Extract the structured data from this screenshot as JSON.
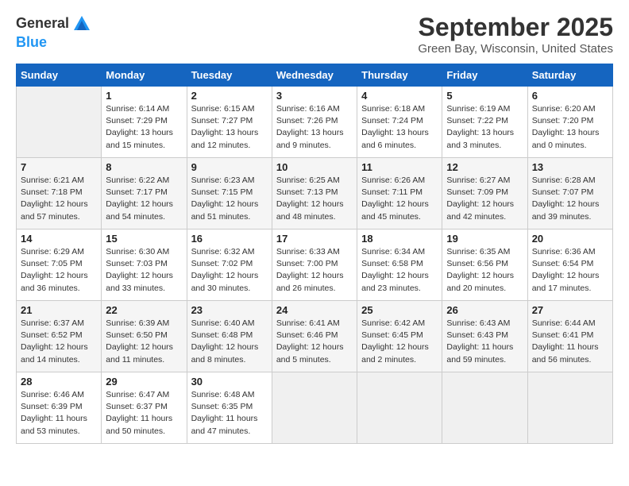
{
  "header": {
    "logo": {
      "line1": "General",
      "line2": "Blue"
    },
    "month": "September 2025",
    "location": "Green Bay, Wisconsin, United States"
  },
  "weekdays": [
    "Sunday",
    "Monday",
    "Tuesday",
    "Wednesday",
    "Thursday",
    "Friday",
    "Saturday"
  ],
  "weeks": [
    [
      {
        "day": "",
        "sunrise": "",
        "sunset": "",
        "daylight": ""
      },
      {
        "day": "1",
        "sunrise": "Sunrise: 6:14 AM",
        "sunset": "Sunset: 7:29 PM",
        "daylight": "Daylight: 13 hours and 15 minutes."
      },
      {
        "day": "2",
        "sunrise": "Sunrise: 6:15 AM",
        "sunset": "Sunset: 7:27 PM",
        "daylight": "Daylight: 13 hours and 12 minutes."
      },
      {
        "day": "3",
        "sunrise": "Sunrise: 6:16 AM",
        "sunset": "Sunset: 7:26 PM",
        "daylight": "Daylight: 13 hours and 9 minutes."
      },
      {
        "day": "4",
        "sunrise": "Sunrise: 6:18 AM",
        "sunset": "Sunset: 7:24 PM",
        "daylight": "Daylight: 13 hours and 6 minutes."
      },
      {
        "day": "5",
        "sunrise": "Sunrise: 6:19 AM",
        "sunset": "Sunset: 7:22 PM",
        "daylight": "Daylight: 13 hours and 3 minutes."
      },
      {
        "day": "6",
        "sunrise": "Sunrise: 6:20 AM",
        "sunset": "Sunset: 7:20 PM",
        "daylight": "Daylight: 13 hours and 0 minutes."
      }
    ],
    [
      {
        "day": "7",
        "sunrise": "Sunrise: 6:21 AM",
        "sunset": "Sunset: 7:18 PM",
        "daylight": "Daylight: 12 hours and 57 minutes."
      },
      {
        "day": "8",
        "sunrise": "Sunrise: 6:22 AM",
        "sunset": "Sunset: 7:17 PM",
        "daylight": "Daylight: 12 hours and 54 minutes."
      },
      {
        "day": "9",
        "sunrise": "Sunrise: 6:23 AM",
        "sunset": "Sunset: 7:15 PM",
        "daylight": "Daylight: 12 hours and 51 minutes."
      },
      {
        "day": "10",
        "sunrise": "Sunrise: 6:25 AM",
        "sunset": "Sunset: 7:13 PM",
        "daylight": "Daylight: 12 hours and 48 minutes."
      },
      {
        "day": "11",
        "sunrise": "Sunrise: 6:26 AM",
        "sunset": "Sunset: 7:11 PM",
        "daylight": "Daylight: 12 hours and 45 minutes."
      },
      {
        "day": "12",
        "sunrise": "Sunrise: 6:27 AM",
        "sunset": "Sunset: 7:09 PM",
        "daylight": "Daylight: 12 hours and 42 minutes."
      },
      {
        "day": "13",
        "sunrise": "Sunrise: 6:28 AM",
        "sunset": "Sunset: 7:07 PM",
        "daylight": "Daylight: 12 hours and 39 minutes."
      }
    ],
    [
      {
        "day": "14",
        "sunrise": "Sunrise: 6:29 AM",
        "sunset": "Sunset: 7:05 PM",
        "daylight": "Daylight: 12 hours and 36 minutes."
      },
      {
        "day": "15",
        "sunrise": "Sunrise: 6:30 AM",
        "sunset": "Sunset: 7:03 PM",
        "daylight": "Daylight: 12 hours and 33 minutes."
      },
      {
        "day": "16",
        "sunrise": "Sunrise: 6:32 AM",
        "sunset": "Sunset: 7:02 PM",
        "daylight": "Daylight: 12 hours and 30 minutes."
      },
      {
        "day": "17",
        "sunrise": "Sunrise: 6:33 AM",
        "sunset": "Sunset: 7:00 PM",
        "daylight": "Daylight: 12 hours and 26 minutes."
      },
      {
        "day": "18",
        "sunrise": "Sunrise: 6:34 AM",
        "sunset": "Sunset: 6:58 PM",
        "daylight": "Daylight: 12 hours and 23 minutes."
      },
      {
        "day": "19",
        "sunrise": "Sunrise: 6:35 AM",
        "sunset": "Sunset: 6:56 PM",
        "daylight": "Daylight: 12 hours and 20 minutes."
      },
      {
        "day": "20",
        "sunrise": "Sunrise: 6:36 AM",
        "sunset": "Sunset: 6:54 PM",
        "daylight": "Daylight: 12 hours and 17 minutes."
      }
    ],
    [
      {
        "day": "21",
        "sunrise": "Sunrise: 6:37 AM",
        "sunset": "Sunset: 6:52 PM",
        "daylight": "Daylight: 12 hours and 14 minutes."
      },
      {
        "day": "22",
        "sunrise": "Sunrise: 6:39 AM",
        "sunset": "Sunset: 6:50 PM",
        "daylight": "Daylight: 12 hours and 11 minutes."
      },
      {
        "day": "23",
        "sunrise": "Sunrise: 6:40 AM",
        "sunset": "Sunset: 6:48 PM",
        "daylight": "Daylight: 12 hours and 8 minutes."
      },
      {
        "day": "24",
        "sunrise": "Sunrise: 6:41 AM",
        "sunset": "Sunset: 6:46 PM",
        "daylight": "Daylight: 12 hours and 5 minutes."
      },
      {
        "day": "25",
        "sunrise": "Sunrise: 6:42 AM",
        "sunset": "Sunset: 6:45 PM",
        "daylight": "Daylight: 12 hours and 2 minutes."
      },
      {
        "day": "26",
        "sunrise": "Sunrise: 6:43 AM",
        "sunset": "Sunset: 6:43 PM",
        "daylight": "Daylight: 11 hours and 59 minutes."
      },
      {
        "day": "27",
        "sunrise": "Sunrise: 6:44 AM",
        "sunset": "Sunset: 6:41 PM",
        "daylight": "Daylight: 11 hours and 56 minutes."
      }
    ],
    [
      {
        "day": "28",
        "sunrise": "Sunrise: 6:46 AM",
        "sunset": "Sunset: 6:39 PM",
        "daylight": "Daylight: 11 hours and 53 minutes."
      },
      {
        "day": "29",
        "sunrise": "Sunrise: 6:47 AM",
        "sunset": "Sunset: 6:37 PM",
        "daylight": "Daylight: 11 hours and 50 minutes."
      },
      {
        "day": "30",
        "sunrise": "Sunrise: 6:48 AM",
        "sunset": "Sunset: 6:35 PM",
        "daylight": "Daylight: 11 hours and 47 minutes."
      },
      {
        "day": "",
        "sunrise": "",
        "sunset": "",
        "daylight": ""
      },
      {
        "day": "",
        "sunrise": "",
        "sunset": "",
        "daylight": ""
      },
      {
        "day": "",
        "sunrise": "",
        "sunset": "",
        "daylight": ""
      },
      {
        "day": "",
        "sunrise": "",
        "sunset": "",
        "daylight": ""
      }
    ]
  ]
}
